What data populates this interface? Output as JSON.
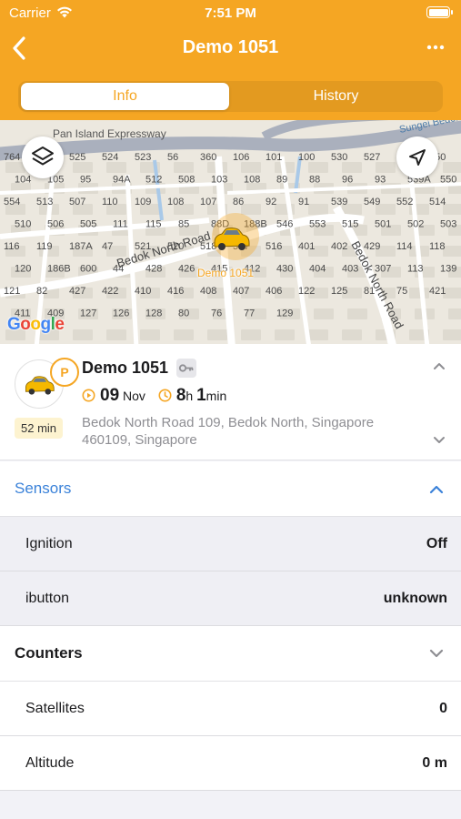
{
  "status_bar": {
    "carrier": "Carrier",
    "time": "7:51 PM"
  },
  "nav": {
    "title": "Demo 1051"
  },
  "tabs": [
    {
      "label": "Info",
      "active": true
    },
    {
      "label": "History",
      "active": false
    }
  ],
  "map": {
    "vehicle_label": "Demo 1051",
    "google_logo": [
      "G",
      "o",
      "o",
      "g",
      "l",
      "e"
    ],
    "roads": {
      "expressway": "Pan Island Expressway",
      "road1": "Bedok North Road",
      "road2": "Bedok North Road",
      "road3": "Sungei Bedok"
    },
    "block_numbers": [
      "764",
      "768",
      "525",
      "524",
      "523",
      "56",
      "360",
      "106",
      "101",
      "100",
      "530",
      "527",
      "526",
      "350",
      "104",
      "105",
      "95",
      "94A",
      "512",
      "508",
      "103",
      "108",
      "89",
      "88",
      "96",
      "93",
      "539A",
      "550",
      "554",
      "513",
      "507",
      "110",
      "109",
      "108",
      "107",
      "86",
      "92",
      "91",
      "539",
      "549",
      "552",
      "514",
      "510",
      "506",
      "505",
      "111",
      "115",
      "85",
      "88D",
      "188B",
      "546",
      "553",
      "515",
      "501",
      "502",
      "503",
      "116",
      "119",
      "187A",
      "47",
      "521",
      "520",
      "518",
      "517",
      "516",
      "401",
      "402",
      "429",
      "114",
      "118",
      "120",
      "186B",
      "600",
      "44",
      "428",
      "426",
      "415",
      "412",
      "430",
      "404",
      "403",
      "307",
      "113",
      "139",
      "121",
      "82",
      "427",
      "422",
      "410",
      "416",
      "408",
      "407",
      "406",
      "122",
      "125",
      "81",
      "75",
      "421",
      "411",
      "409",
      "127",
      "126",
      "128",
      "80",
      "76",
      "77",
      "129"
    ],
    "colors": {
      "road_major": "#a3a8b6",
      "accent": "#f5a623"
    }
  },
  "vehicle": {
    "name": "Demo 1051",
    "parking_badge": "P",
    "duration": "52 min",
    "date_day": "09",
    "date_month": "Nov",
    "elapsed_hours": "8",
    "elapsed_hours_unit": "h",
    "elapsed_minutes": "1",
    "elapsed_minutes_unit": "min",
    "address": "Bedok North Road 109, Bedok North, Singapore 460109, Singapore"
  },
  "sensors": {
    "title": "Sensors",
    "expanded": true,
    "rows": [
      {
        "label": "Ignition",
        "value": "Off"
      },
      {
        "label": "ibutton",
        "value": "unknown"
      }
    ]
  },
  "counters": {
    "title": "Counters",
    "expanded": false,
    "rows": [
      {
        "label": "Satellites",
        "value": "0"
      },
      {
        "label": "Altitude",
        "value": "0 m"
      }
    ]
  },
  "icons": [
    "wifi-icon",
    "battery-icon",
    "back-icon",
    "more-icon",
    "layers-icon",
    "locate-icon",
    "car-icon",
    "key-icon",
    "play-clock-icon",
    "clock-icon",
    "chevron-up-icon",
    "chevron-down-icon"
  ]
}
